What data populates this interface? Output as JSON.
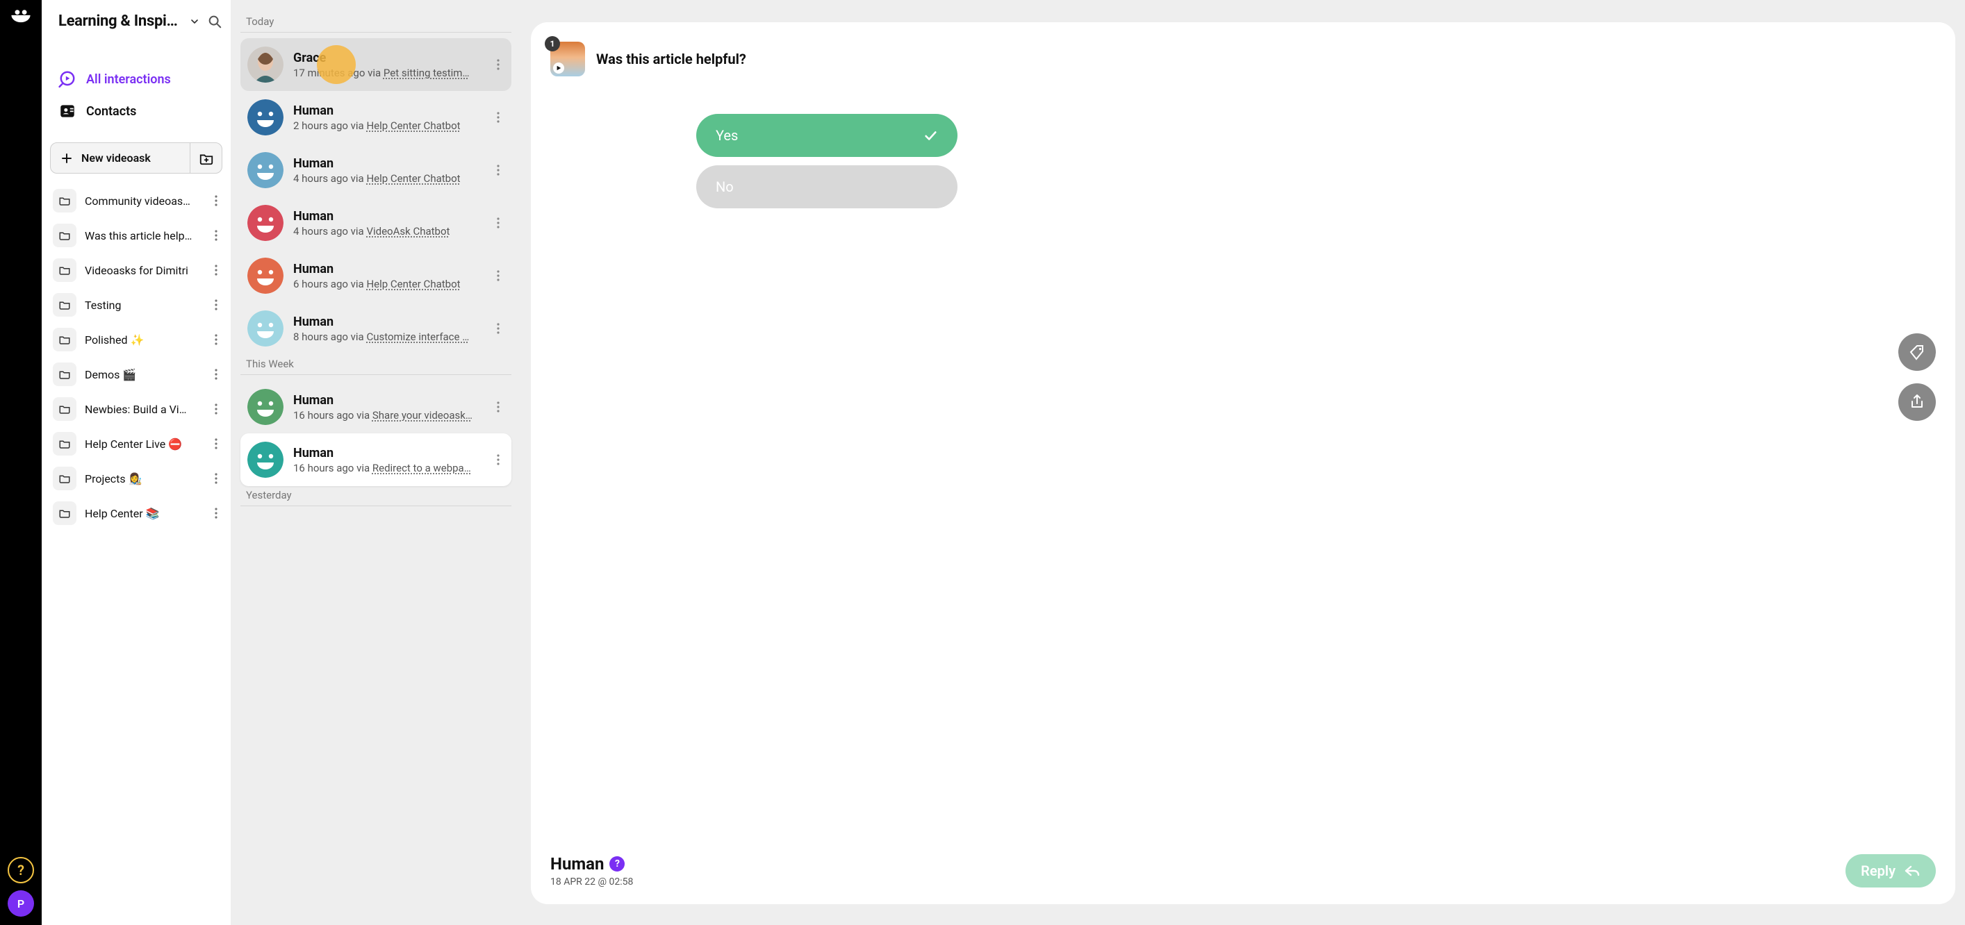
{
  "workspace": {
    "title": "Learning & Inspi…"
  },
  "nav": {
    "all_interactions": "All interactions",
    "contacts": "Contacts"
  },
  "new_videoask_label": "New videoask",
  "folders": [
    {
      "label": "Community videoas…"
    },
    {
      "label": "Was this article help…"
    },
    {
      "label": "Videoasks for Dimitri"
    },
    {
      "label": "Testing"
    },
    {
      "label": "Polished ✨"
    },
    {
      "label": "Demos 🎬"
    },
    {
      "label": "Newbies: Build a Vi…"
    },
    {
      "label": "Help Center Live ⛔"
    },
    {
      "label": "Projects 👩‍🎨"
    },
    {
      "label": "Help Center 📚"
    }
  ],
  "list": {
    "sections": [
      {
        "heading": "Today",
        "items": [
          {
            "name": "Grace",
            "time": "17 minutes ago",
            "via": "via",
            "source": "Pet sitting testim…",
            "avatar": "photo",
            "highlight": true,
            "pulse": true
          },
          {
            "name": "Human",
            "time": "2 hours ago",
            "via": "via",
            "source": "Help Center Chatbot",
            "avatar": "smiley",
            "color": "#2e6ca0"
          },
          {
            "name": "Human",
            "time": "4 hours ago",
            "via": "via",
            "source": "Help Center Chatbot",
            "avatar": "smiley",
            "color": "#6aa8c9"
          },
          {
            "name": "Human",
            "time": "4 hours ago",
            "via": "via",
            "source": "VideoAsk Chatbot",
            "avatar": "smiley",
            "color": "#d84a5a"
          },
          {
            "name": "Human",
            "time": "6 hours ago",
            "via": "via",
            "source": "Help Center Chatbot",
            "avatar": "smiley",
            "color": "#e26a4a"
          },
          {
            "name": "Human",
            "time": "8 hours ago",
            "via": "via",
            "source": "Customize interface …",
            "avatar": "smiley",
            "color": "#9fd6e2"
          }
        ]
      },
      {
        "heading": "This Week",
        "items": [
          {
            "name": "Human",
            "time": "16 hours ago",
            "via": "via",
            "source": "Share your videoask…",
            "avatar": "smiley",
            "color": "#57a36b"
          },
          {
            "name": "Human",
            "time": "16 hours ago",
            "via": "via",
            "source": "Redirect to a webpa…",
            "avatar": "smiley",
            "color": "#2aa79a",
            "selected": true
          }
        ]
      },
      {
        "heading": "Yesterday",
        "items": []
      }
    ]
  },
  "detail": {
    "badge": "1",
    "title": "Was this article helpful?",
    "answers": {
      "yes": "Yes",
      "no": "No"
    },
    "footer": {
      "name": "Human",
      "timestamp": "18 APR 22 @ 02:58",
      "reply_label": "Reply"
    }
  },
  "rail": {
    "help_char": "?",
    "avatar_letter": "P"
  }
}
